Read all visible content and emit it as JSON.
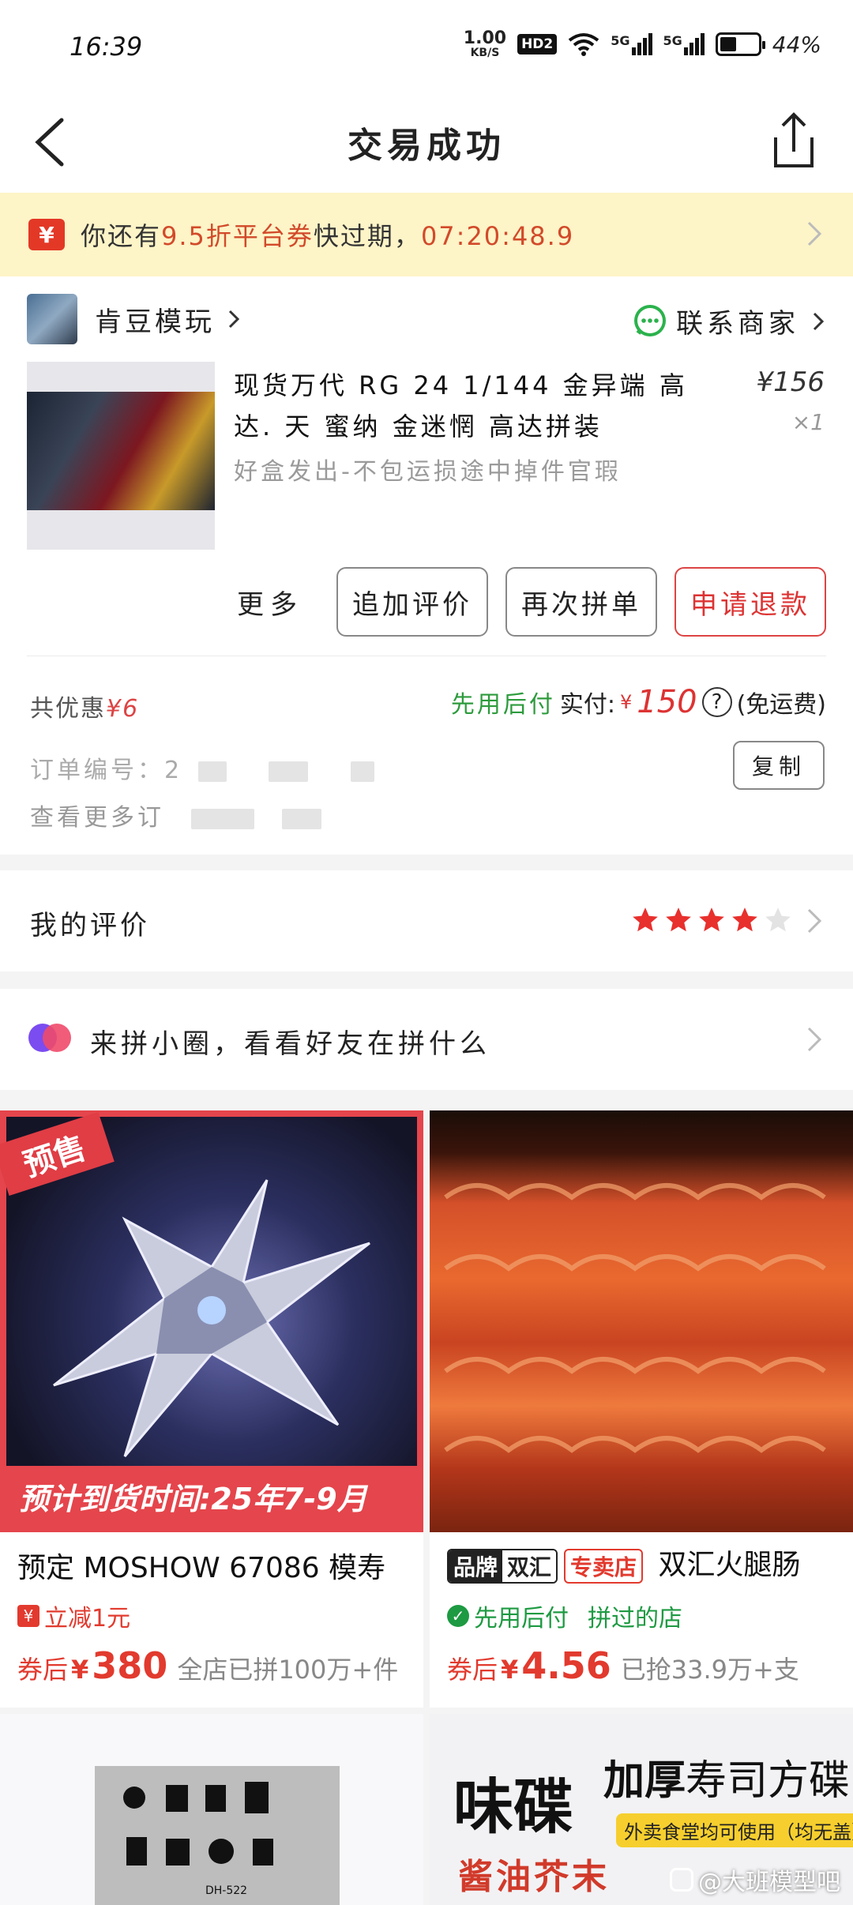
{
  "status_bar": {
    "time": "16:39",
    "net_speed_value": "1.00",
    "net_speed_unit": "KB/S",
    "hd_badge": "HD2",
    "sim1": "5G",
    "sim2": "5G",
    "battery_percent": "44%",
    "battery_level": 0.44
  },
  "nav": {
    "title": "交易成功",
    "back_icon": "chevron-left-icon",
    "share_icon": "share-icon"
  },
  "coupon_banner": {
    "ticket_glyph": "¥",
    "text_prefix": "你还有",
    "highlight": "9.5折平台券",
    "text_mid": "快过期，",
    "countdown": "07:20:48.9",
    "bg_color": "#fdf4c7"
  },
  "order": {
    "shop_name": "肯豆模玩",
    "contact_label": "联系商家",
    "product": {
      "title": "现货万代 RG 24 1/144 金异端 高达. 天 蜜纳 金迷惘 高达拼装",
      "price": "¥156",
      "qty": "×1",
      "subtitle": "好盒发出-不包运损途中掉件官瑕"
    },
    "actions": {
      "more": "更多",
      "add_review": "追加评价",
      "reorder": "再次拼单",
      "refund": "申请退款"
    },
    "discount_label": "共优惠",
    "discount_value": "¥6",
    "pay_later": "先用后付",
    "paid_label": "实付:",
    "paid_currency": "¥",
    "paid_amount": "150",
    "help_glyph": "?",
    "shipping_note": "(免运费)",
    "order_no_label": "订单编号：2",
    "more_info_label": "查看更多订",
    "copy_label": "复制"
  },
  "review": {
    "label": "我的评价",
    "rating": 4,
    "max_rating": 5,
    "star_color": "#e8302d"
  },
  "circle": {
    "label": "来拼小圈，看看好友在拼什么"
  },
  "feed": [
    {
      "tag": "预售",
      "eta": "预计到货时间:25年7-9月",
      "title": "预定 MOSHOW 67086 模寿",
      "promo": "立减1元",
      "price_prefix": "券后",
      "currency": "¥",
      "price": "380",
      "sold": "全店已拼100万+件"
    },
    {
      "brand_a": "品牌",
      "brand_b": "双汇",
      "store_tag": "专卖店",
      "title": "双汇火腿肠",
      "pay_later": "先用后付",
      "visited": "拼过的店",
      "price_prefix": "券后",
      "currency": "¥",
      "price": "4.56",
      "sold": "已抢33.9万+支"
    },
    {
      "thumb_code": "DH-522"
    },
    {
      "headline_big": "味碟",
      "headline_bold": "加厚",
      "headline_rest": "寿司方碟",
      "subline": "外卖食堂均可使用（均无盖）",
      "flavor": "酱油芥末"
    }
  ],
  "watermark": "@大班模型吧"
}
